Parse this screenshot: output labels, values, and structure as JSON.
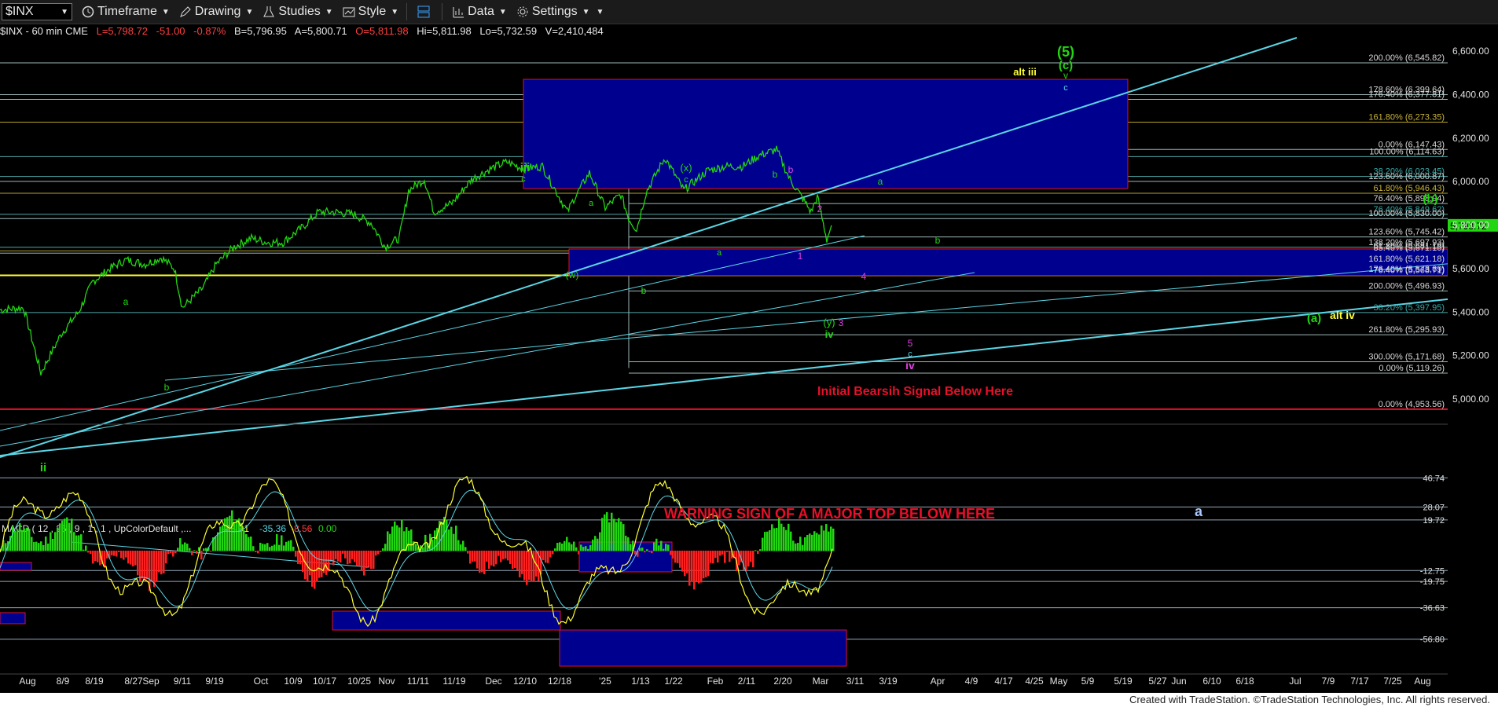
{
  "toolbar": {
    "symbol": "$INX",
    "timeframe": "Timeframe",
    "drawing": "Drawing",
    "studies": "Studies",
    "style": "Style",
    "data": "Data",
    "settings": "Settings"
  },
  "infobar": {
    "title": "$INX - 60 min  CME",
    "last": "L=5,798.72",
    "chg": "-51.00",
    "pct": "-0.87%",
    "bid": "B=5,796.95",
    "ask": "A=5,800.71",
    "open": "O=5,811.98",
    "hi": "Hi=5,811.98",
    "lo": "Lo=5,732.59",
    "vol": "V=2,410,484"
  },
  "footer": "Created with TradeStation. ©TradeStation Technologies, Inc. All rights reserved.",
  "colors": {
    "price": "#22d611",
    "trend": "#5ad6e6",
    "box": "#00008f",
    "boxBorder": "#e0102f",
    "yellow": "#ffff33",
    "red": "#e8102a"
  },
  "chart_data": [
    {
      "type": "line",
      "title": "$INX - 60 min",
      "xlabel": "",
      "ylabel": "",
      "ylim": [
        4900,
        6700
      ],
      "grid": false,
      "price_axis_ticks": [
        "6,600.00",
        "6,400.00",
        "6,200.00",
        "6,000.00",
        "5,800.00",
        "5,600.00",
        "5,400.00",
        "5,200.00",
        "5,000.00"
      ],
      "last_price_tag": "5,798.72",
      "x_ticks": [
        "Aug",
        "8/9",
        "8/19",
        "8/27",
        "Sep",
        "9/11",
        "9/19",
        "Oct",
        "10/9",
        "10/17",
        "10/25",
        "Nov",
        "11/11",
        "11/19",
        "Dec",
        "12/10",
        "12/18",
        "'25",
        "1/13",
        "1/22",
        "Feb",
        "2/11",
        "2/20",
        "Mar",
        "3/11",
        "3/19",
        "Apr",
        "4/9",
        "4/17",
        "4/25",
        "May",
        "5/9",
        "5/19",
        "5/27",
        "Jun",
        "6/10",
        "6/18",
        "Jul",
        "7/9",
        "7/17",
        "7/25",
        "Aug"
      ],
      "series": [
        {
          "values": [
            [
              "Aug",
              5410
            ],
            [
              "8/1",
              5420
            ],
            [
              "8/5",
              5120
            ],
            [
              "8/9",
              5300
            ],
            [
              "8/13",
              5400
            ],
            [
              "8/16",
              5540
            ],
            [
              "8/19",
              5600
            ],
            [
              "8/23",
              5640
            ],
            [
              "8/27",
              5620
            ],
            [
              "8/30",
              5650
            ],
            [
              "Sep",
              5600
            ],
            [
              "9/6",
              5420
            ],
            [
              "9/11",
              5510
            ],
            [
              "9/13",
              5620
            ],
            [
              "9/19",
              5700
            ],
            [
              "9/24",
              5740
            ],
            [
              "Oct",
              5720
            ],
            [
              "10/7",
              5720
            ],
            [
              "10/9",
              5790
            ],
            [
              "10/14",
              5860
            ],
            [
              "10/17",
              5860
            ],
            [
              "10/21",
              5850
            ],
            [
              "10/25",
              5810
            ],
            [
              "10/31",
              5700
            ],
            [
              "Nov",
              5740
            ],
            [
              "11/6",
              5960
            ],
            [
              "11/11",
              6010
            ],
            [
              "11/15",
              5860
            ],
            [
              "11/19",
              5900
            ],
            [
              "11/25",
              6010
            ],
            [
              "Dec",
              6060
            ],
            [
              "12/6",
              6090
            ],
            [
              "12/10",
              6060
            ],
            [
              "12/16",
              6070
            ],
            [
              "12/18",
              5860
            ],
            [
              "12/20",
              5920
            ],
            [
              "12/26",
              6040
            ],
            [
              "'25",
              5880
            ],
            [
              "1/7",
              5940
            ],
            [
              "1/10",
              5830
            ],
            [
              "1/13",
              5780
            ],
            [
              "1/15",
              5950
            ],
            [
              "1/22",
              6110
            ],
            [
              "1/27",
              5960
            ],
            [
              "Feb",
              6050
            ],
            [
              "2/5",
              6070
            ],
            [
              "2/11",
              6070
            ],
            [
              "2/14",
              6120
            ],
            [
              "2/19",
              6147
            ],
            [
              "2/21",
              6010
            ],
            [
              "2/25",
              5930
            ],
            [
              "2/27",
              5860
            ],
            [
              "Mar",
              5930
            ],
            [
              "3/3",
              5733
            ],
            [
              "3/4",
              5799
            ]
          ]
        }
      ],
      "horizontal_levels": [
        {
          "label": "200.00% (6,545.82)",
          "value": 6545.82
        },
        {
          "label": "178.60% (6,399.64)",
          "value": 6399.64
        },
        {
          "label": "176.40% (6,377.81)",
          "value": 6377.81
        },
        {
          "label": "161.80% (6,273.35)",
          "value": 6273.35
        },
        {
          "label": "0.00% (6,147.43)",
          "value": 6147.43
        },
        {
          "label": "100.00% (6,114.63)",
          "value": 6114.63
        },
        {
          "label": "38.20% (6,023.45)",
          "value": 6023.45
        },
        {
          "label": "123.60% (6,000.87)",
          "value": 6000.87
        },
        {
          "label": "61.80% (5,946.43)",
          "value": 5946.43
        },
        {
          "label": "76.40% (5,898.94)",
          "value": 5898.94
        },
        {
          "label": "76.40% (5,849.62)",
          "value": 5849.62
        },
        {
          "label": "100.00% (5,830.00)",
          "value": 5830.0
        },
        {
          "label": "123.60% (5,745.42)",
          "value": 5745.42
        },
        {
          "label": "138.20% (5,697.93)",
          "value": 5697.93
        },
        {
          "label": "61.80% (5,681.19)",
          "value": 5681.19
        },
        {
          "label": "85.40% (5,671.10)",
          "value": 5671.1
        },
        {
          "label": "161.80% (5,621.18)",
          "value": 5621.18
        },
        {
          "label": "176.40% (5,573.69)",
          "value": 5573.69
        },
        {
          "label": "76.40% (5,568.71)",
          "value": 5568.71
        },
        {
          "label": "200.00% (5,496.93)",
          "value": 5496.93
        },
        {
          "label": "38.20% (5,397.95)",
          "value": 5397.95
        },
        {
          "label": "261.80% (5,295.93)",
          "value": 5295.93
        },
        {
          "label": "300.00% (5,171.68)",
          "value": 5171.68
        },
        {
          "label": "0.00% (5,119.26)",
          "value": 5119.26
        },
        {
          "label": "0.00% (4,953.56)",
          "value": 4953.56
        }
      ],
      "wave_labels": [
        "(5)",
        "(c)",
        "v",
        "c",
        "alt iii",
        "iii",
        "c",
        "(x)",
        "c",
        "b",
        "b",
        "a",
        "2",
        "1",
        "b",
        "a",
        "4",
        "(w)",
        "b",
        "a",
        "b",
        "a",
        "ii",
        "(y)",
        "3",
        "iv",
        "5",
        "c",
        "iv",
        "(a)",
        "alt iv",
        "(b)",
        "a"
      ],
      "annotations": [
        "Initial Bearsih Signal Below Here",
        "WARNING SIGN OF A MAJOR TOP BELOW HERE"
      ]
    },
    {
      "type": "area",
      "title": "MACD ( 12 , 26 , 9 , 1 , 1 , UpColorDefault ,...",
      "legend_values": [
        "-43.91",
        "-35.36",
        "-8.56",
        "0.00"
      ],
      "ylim": [
        -64,
        50
      ],
      "axis_ticks": [
        "40.00",
        "20.00",
        "0.00",
        "-20.00",
        "-40.00",
        "-60.00"
      ],
      "levels": [
        "46.74",
        "28.07",
        "19.72",
        "-12.75",
        "-19.75",
        "-36.63",
        "-56.80"
      ],
      "last_value_tag": "-8.56"
    }
  ]
}
